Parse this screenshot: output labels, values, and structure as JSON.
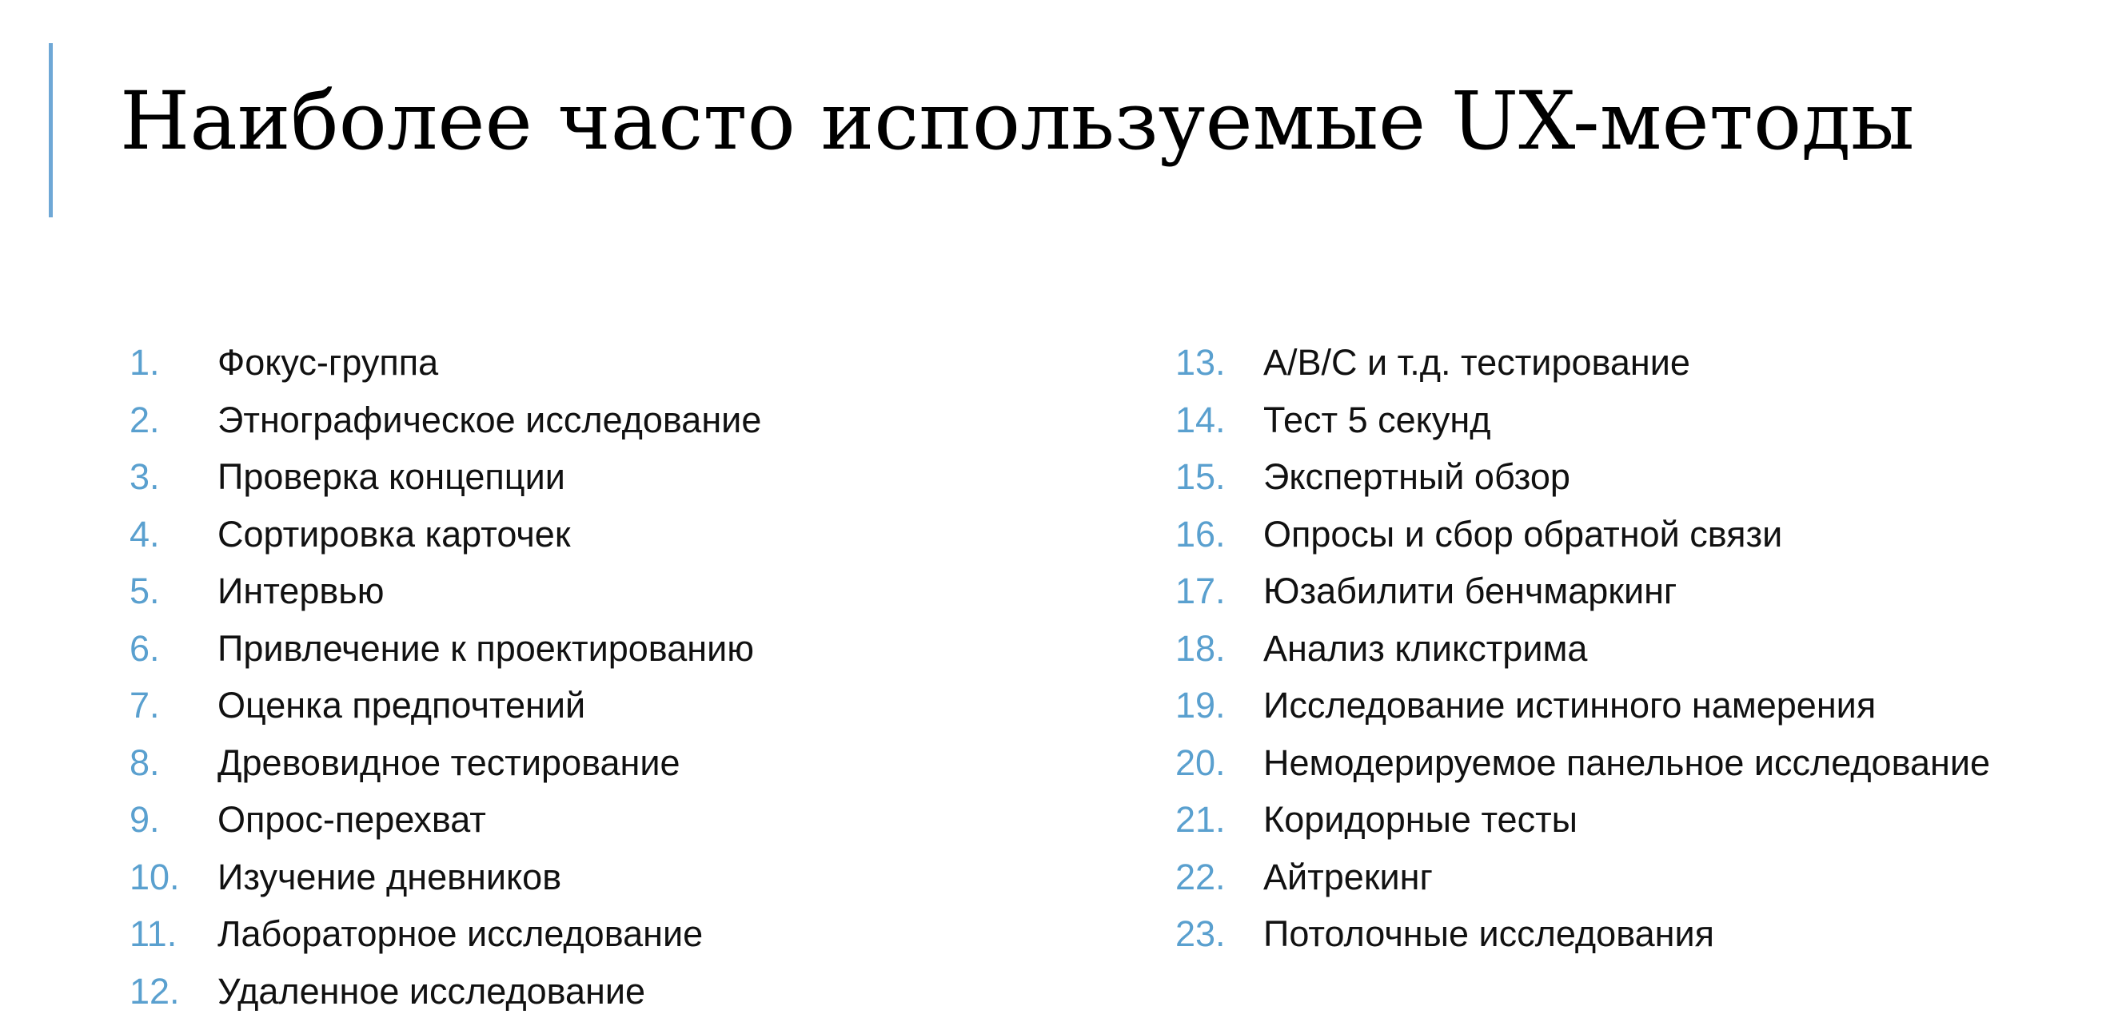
{
  "slide": {
    "title": "Наиболее часто используемые UX-методы",
    "accent_color": "#5aa0cf",
    "left_column": [
      {
        "num": "1.",
        "label": "Фокус-группа"
      },
      {
        "num": "2.",
        "label": "Этнографическое исследование"
      },
      {
        "num": "3.",
        "label": "Проверка концепции"
      },
      {
        "num": "4.",
        "label": "Сортировка карточек"
      },
      {
        "num": "5.",
        "label": "Интервью"
      },
      {
        "num": "6.",
        "label": "Привлечение к проектированию"
      },
      {
        "num": "7.",
        "label": "Оценка предпочтений"
      },
      {
        "num": "8.",
        "label": "Древовидное тестирование"
      },
      {
        "num": "9.",
        "label": "Опрос-перехват"
      },
      {
        "num": "10.",
        "label": "Изучение дневников"
      },
      {
        "num": "11.",
        "label": "Лабораторное исследование"
      },
      {
        "num": "12.",
        "label": "Удаленное исследование"
      }
    ],
    "right_column": [
      {
        "num": "13.",
        "label": "A/B/C и т.д. тестирование"
      },
      {
        "num": "14.",
        "label": "Тест 5 секунд"
      },
      {
        "num": "15.",
        "label": "Экспертный обзор"
      },
      {
        "num": "16.",
        "label": "Опросы и сбор обратной связи"
      },
      {
        "num": "17.",
        "label": "Юзабилити бенчмаркинг"
      },
      {
        "num": "18.",
        "label": "Анализ кликстрима"
      },
      {
        "num": "19.",
        "label": "Исследование истинного намерения"
      },
      {
        "num": "20.",
        "label": "Немодерируемое панельное исследование"
      },
      {
        "num": "21.",
        "label": "Коридорные тесты"
      },
      {
        "num": "22.",
        "label": "Айтрекинг"
      },
      {
        "num": "23.",
        "label": "Потолочные исследования"
      }
    ]
  }
}
